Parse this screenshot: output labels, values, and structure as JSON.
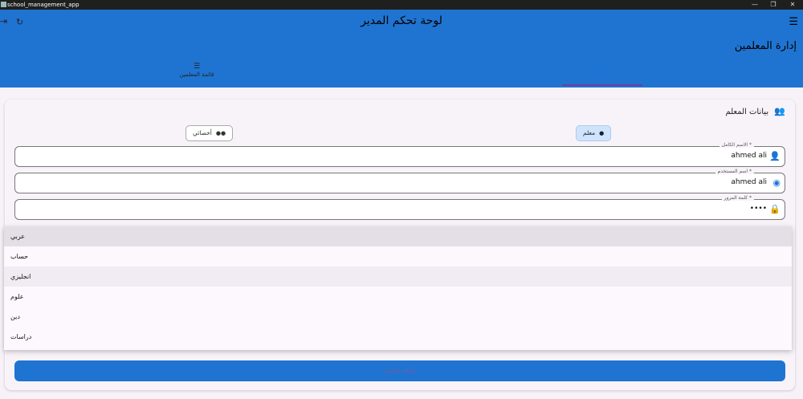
{
  "window": {
    "title": "school_management_app",
    "minimize": "—",
    "restore": "❐",
    "close": "✕"
  },
  "appbar": {
    "title": "لوحة تحكم المدير",
    "subtitle": "إدارة المعلمين",
    "menu_icon": "☰",
    "refresh_icon": "↻",
    "logout_icon": "⇥"
  },
  "tabs": [
    {
      "label": "",
      "icon": "👤",
      "icon_name": "person-add-icon"
    },
    {
      "label": "قائمة المعلمين",
      "icon": "☰",
      "icon_name": "list-icon"
    }
  ],
  "form": {
    "header": "بيانات المعلم",
    "header_icon": "👥",
    "role_teacher": "معلم",
    "role_specialist": "أخصائي",
    "fields": [
      {
        "label": "الاسم الكامل *",
        "value": "ahmed ali",
        "icon": "👤"
      },
      {
        "label": "اسم المستخدم *",
        "value": "ahmed ali",
        "icon": "◉"
      },
      {
        "label": "كلمة المرور *",
        "value": "••••",
        "icon": "🔒"
      }
    ],
    "submit_label": "إضافة المعلم"
  },
  "dropdown": {
    "options": [
      "عربي",
      "حساب",
      "انجليزي",
      "علوم",
      "دين",
      "دراسات"
    ]
  },
  "colors": {
    "primary": "#1f74d1",
    "accent": "#6b3fa0",
    "background": "#f7f2f8"
  }
}
